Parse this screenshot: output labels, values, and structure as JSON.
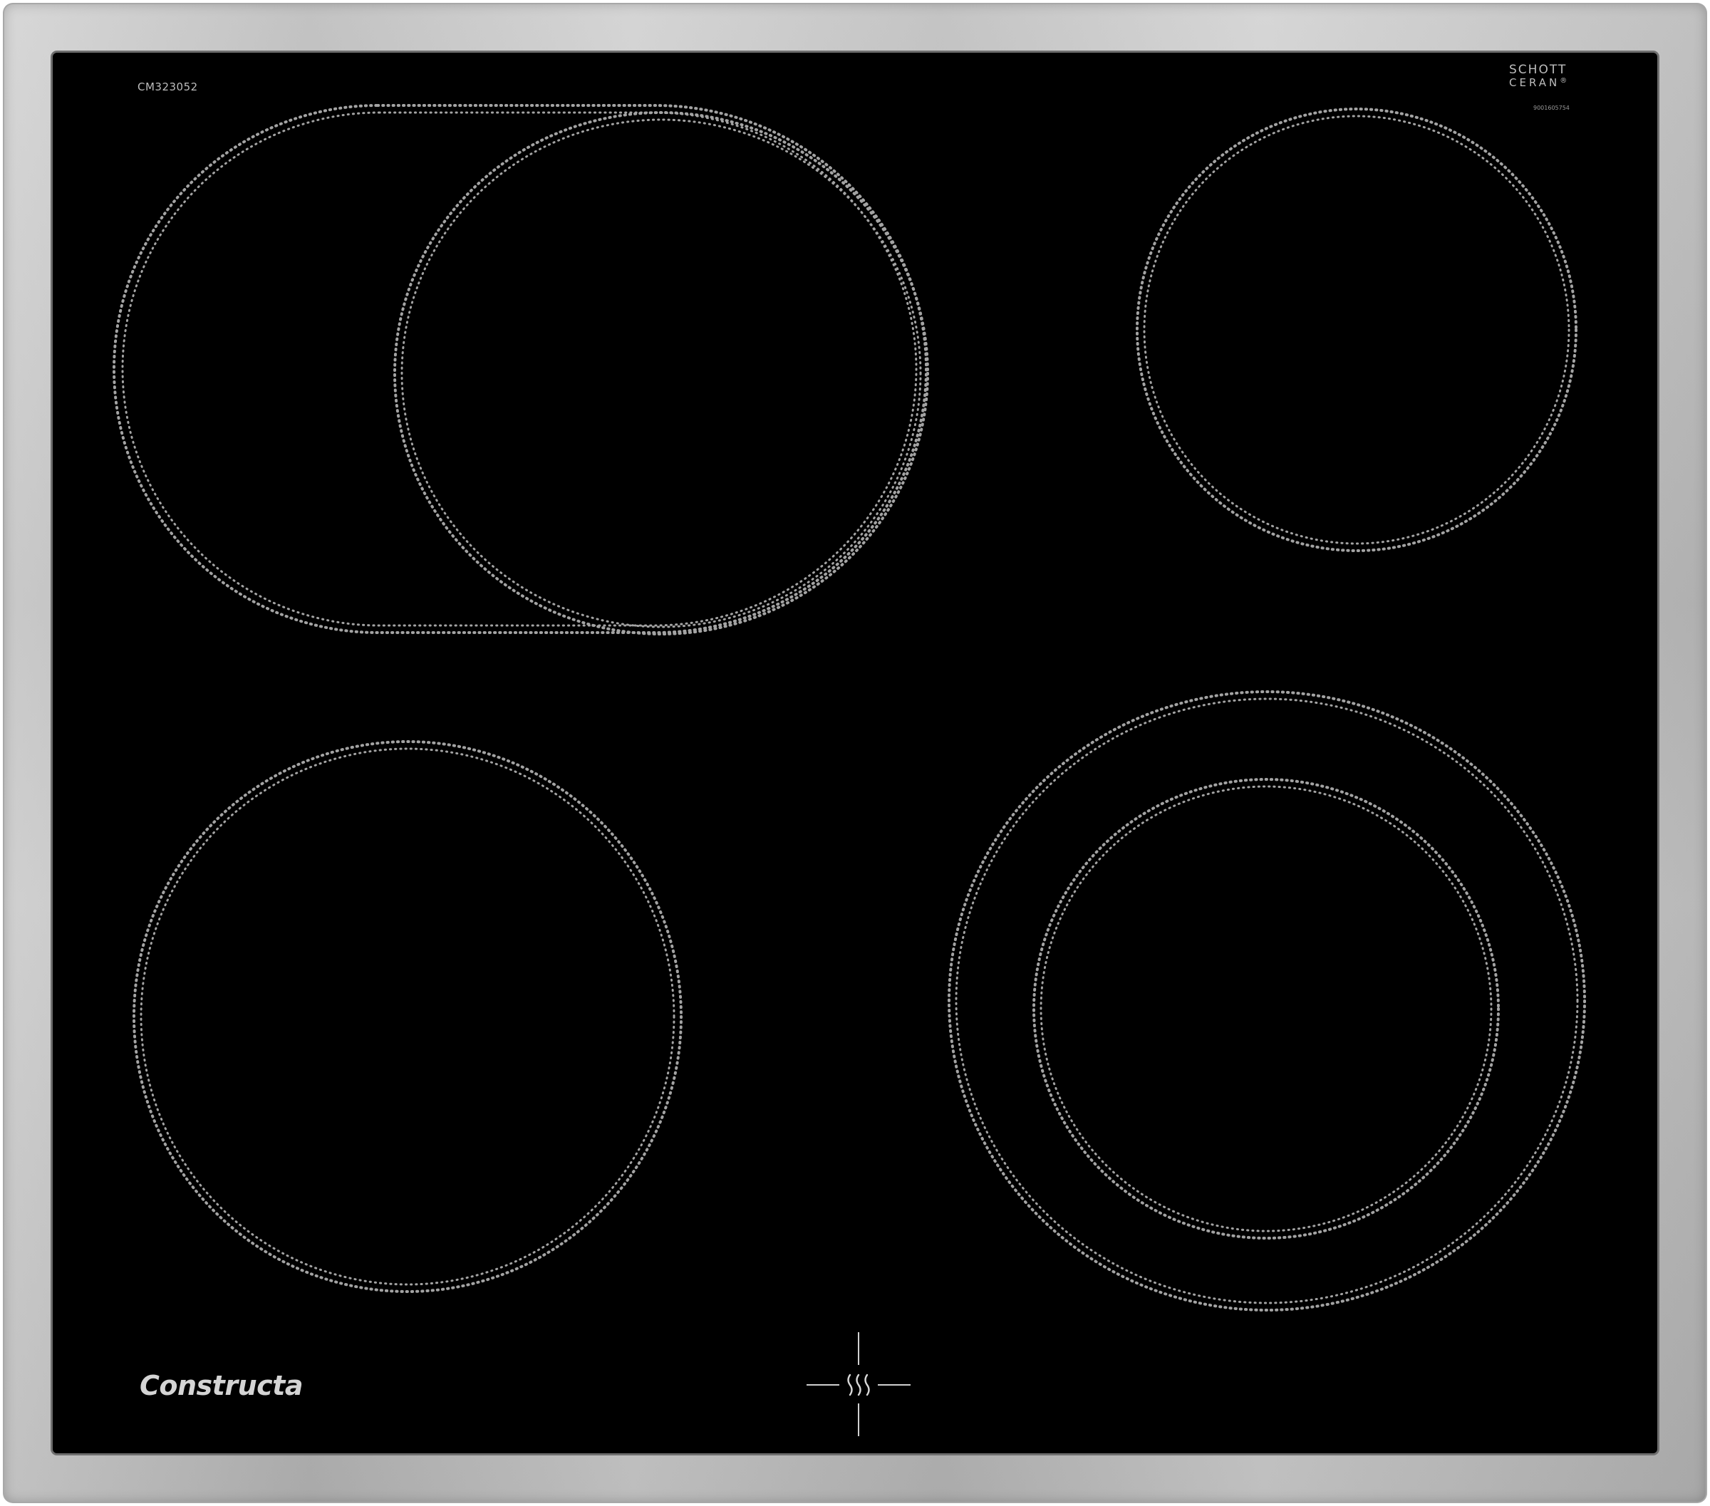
{
  "product": {
    "model_code": "CM323052",
    "brand": "Constructa",
    "glass_brand": {
      "line1": "SCHOTT",
      "line2": "CERAN",
      "registered_mark": "®",
      "serial": "9001605754"
    }
  },
  "cooking_zones": [
    {
      "name": "rear-left-oval-zone",
      "type": "dual-oval",
      "heating": "dotted ring outline"
    },
    {
      "name": "rear-right-zone",
      "type": "single-circle"
    },
    {
      "name": "front-left-zone",
      "type": "single-circle"
    },
    {
      "name": "front-right-zone",
      "type": "dual-circle"
    }
  ],
  "icons": {
    "heat_indicator": "residual-heat-icon",
    "crosshair": "zone-position-cross-icon"
  },
  "colors": {
    "glass": "#000000",
    "frame": "#c4c4c4",
    "dots": "#9a9a9a",
    "label_text": "#bdbdbd"
  }
}
